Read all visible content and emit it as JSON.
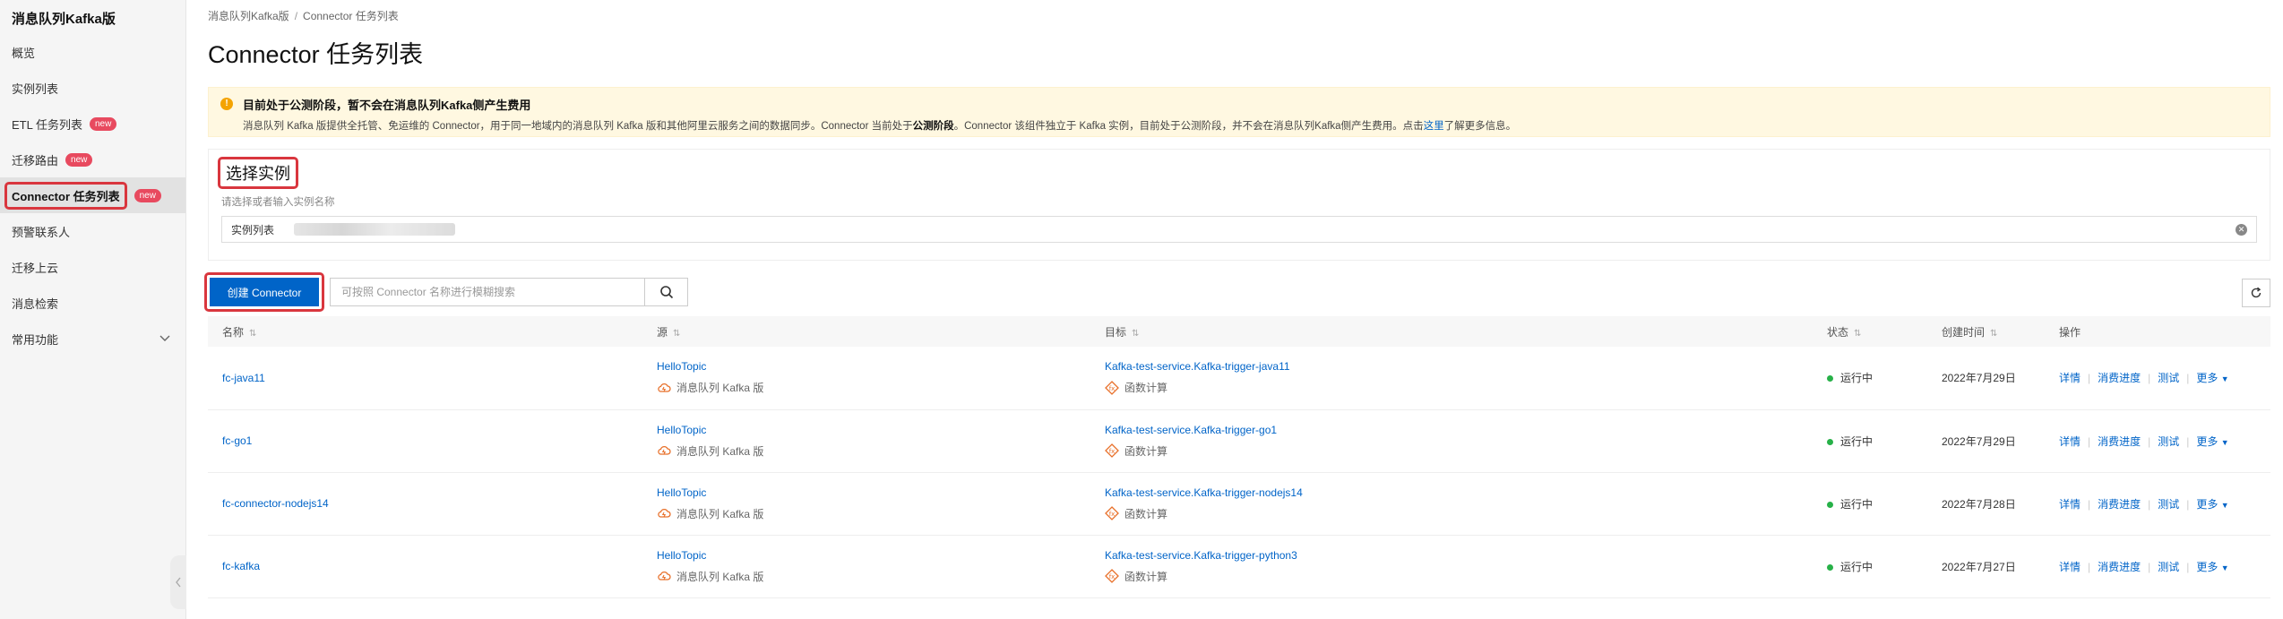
{
  "sidebar": {
    "title": "消息队列Kafka版",
    "items": [
      {
        "label": "概览",
        "badge": ""
      },
      {
        "label": "实例列表",
        "badge": ""
      },
      {
        "label": "ETL 任务列表",
        "badge": "new"
      },
      {
        "label": "迁移路由",
        "badge": "new"
      },
      {
        "label": "Connector 任务列表",
        "badge": "new"
      },
      {
        "label": "预警联系人",
        "badge": ""
      },
      {
        "label": "迁移上云",
        "badge": ""
      },
      {
        "label": "消息检索",
        "badge": ""
      },
      {
        "label": "常用功能",
        "badge": ""
      }
    ]
  },
  "breadcrumb": {
    "root": "消息队列Kafka版",
    "sep": "/",
    "current": "Connector 任务列表"
  },
  "page_title": "Connector 任务列表",
  "notice": {
    "title": "目前处于公测阶段，暂不会在消息队列Kafka侧产生费用",
    "text_1": "消息队列 Kafka 版提供全托管、免运维的 Connector，用于同一地域内的消息队列 Kafka 版和其他阿里云服务之间的数据同步。Connector 当前处于",
    "text_bold": "公测阶段",
    "text_2": "。Connector 该组件独立于 Kafka 实例，目前处于公测阶段，并不会在消息队列Kafka侧产生费用。点击",
    "link": "这里",
    "text_3": "了解更多信息。"
  },
  "instance": {
    "heading": "选择实例",
    "hint": "请选择或者输入实例名称",
    "label": "实例列表"
  },
  "toolbar": {
    "create_label": "创建 Connector",
    "search_placeholder": "可按照 Connector 名称进行模糊搜索"
  },
  "table": {
    "headers": {
      "name": "名称",
      "source": "源",
      "target": "目标",
      "status": "状态",
      "created": "创建时间",
      "ops": "操作"
    },
    "ops": {
      "detail": "详情",
      "progress": "消费进度",
      "test": "测试",
      "more": "更多"
    },
    "rows": [
      {
        "name": "fc-java11",
        "source": "HelloTopic",
        "source_sub": "消息队列 Kafka 版",
        "target": "Kafka-test-service.Kafka-trigger-java11",
        "target_sub": "函数计算",
        "status": "运行中",
        "created": "2022年7月29日"
      },
      {
        "name": "fc-go1",
        "source": "HelloTopic",
        "source_sub": "消息队列 Kafka 版",
        "target": "Kafka-test-service.Kafka-trigger-go1",
        "target_sub": "函数计算",
        "status": "运行中",
        "created": "2022年7月29日"
      },
      {
        "name": "fc-connector-nodejs14",
        "source": "HelloTopic",
        "source_sub": "消息队列 Kafka 版",
        "target": "Kafka-test-service.Kafka-trigger-nodejs14",
        "target_sub": "函数计算",
        "status": "运行中",
        "created": "2022年7月28日"
      },
      {
        "name": "fc-kafka",
        "source": "HelloTopic",
        "source_sub": "消息队列 Kafka 版",
        "target": "Kafka-test-service.Kafka-trigger-python3",
        "target_sub": "函数计算",
        "status": "运行中",
        "created": "2022年7月27日"
      }
    ]
  },
  "colors": {
    "accent": "#0064c8",
    "highlight": "#d9363e",
    "badge": "#e84a5f",
    "status_ok": "#27b148",
    "notice_bg": "#fff8e1",
    "icon_orange": "#e8702a"
  }
}
